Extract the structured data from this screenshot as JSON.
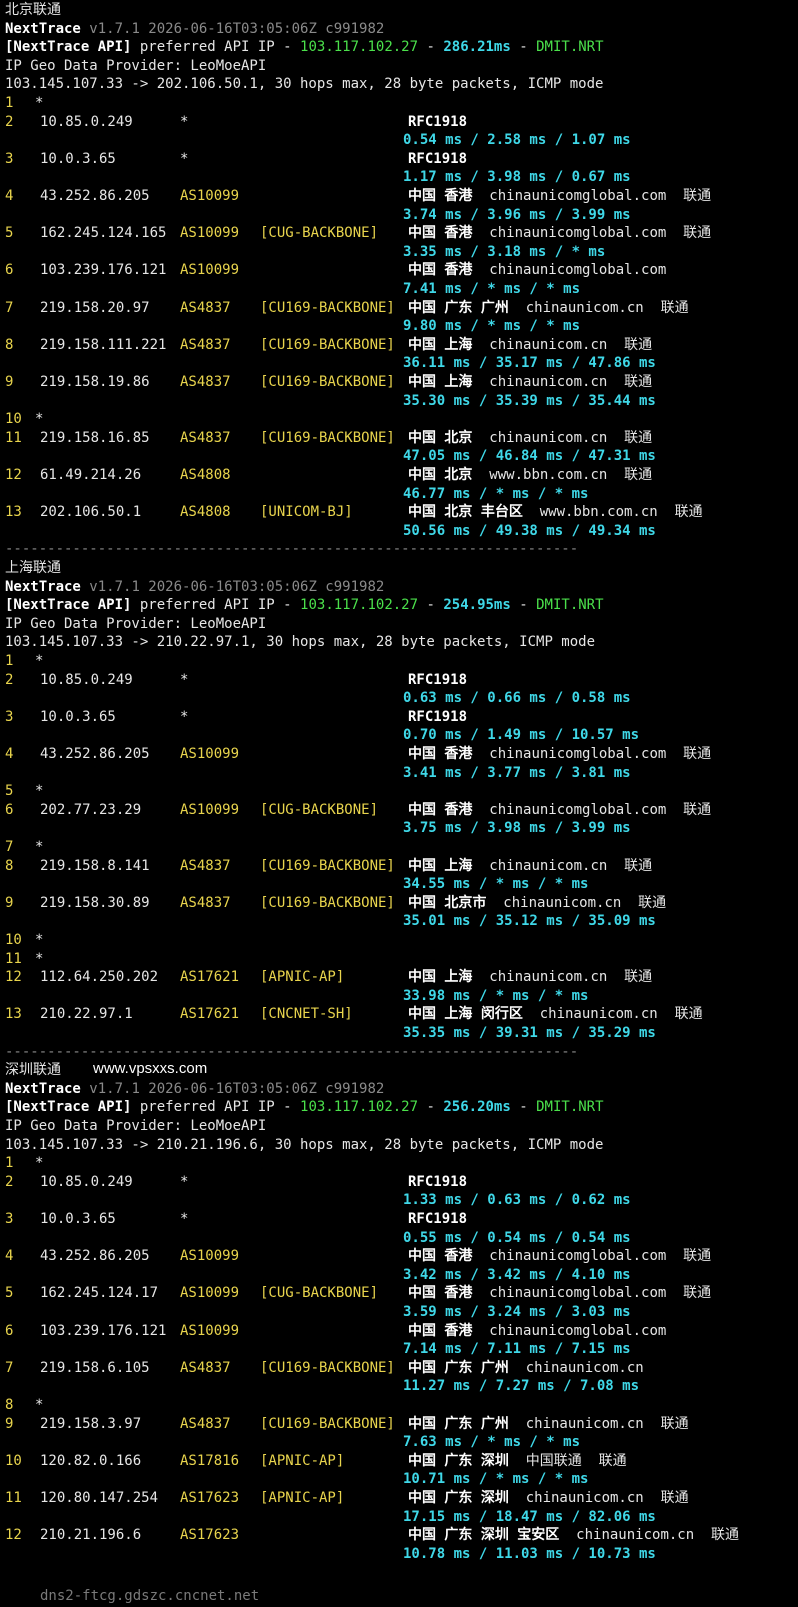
{
  "separator": "--------------------------------------------------------------------",
  "watermark": "www.vpsxxs.com",
  "overlay_hostname": "dns2-ftcg.gdszc.cncnet.net",
  "sections": [
    {
      "title": "北京联通",
      "nt_name": "NextTrace",
      "nt_version": "v1.7.1 2026-06-16T03:05:06Z c991982",
      "api_tag": "[NextTrace API]",
      "api_text": "preferred API IP -",
      "api_ip": "103.117.102.27",
      "api_dash1": "-",
      "api_latency": "286.21ms",
      "api_dash2": "-",
      "api_node": "DMIT.NRT",
      "provider": "IP Geo Data Provider: LeoMoeAPI",
      "route": "103.145.107.33 -> 202.106.50.1, 30 hops max, 28 byte packets, ICMP mode",
      "hops": [
        {
          "n": "1",
          "ip": "*",
          "asn": "",
          "tag": "",
          "geo": "",
          "rtt": ""
        },
        {
          "n": "2",
          "ip": "10.85.0.249",
          "asn": "*",
          "tag": "",
          "geo": "RFC1918",
          "rtt": "0.54 ms / 2.58 ms / 1.07 ms"
        },
        {
          "n": "3",
          "ip": "10.0.3.65",
          "asn": "*",
          "tag": "",
          "geo": "RFC1918",
          "rtt": "1.17 ms / 3.98 ms / 0.67 ms"
        },
        {
          "n": "4",
          "ip": "43.252.86.205",
          "asn": "AS10099",
          "tag": "",
          "geo": "中国 香港",
          "host": "chinaunicomglobal.com",
          "isp": "联通",
          "rtt": "3.74 ms / 3.96 ms / 3.99 ms"
        },
        {
          "n": "5",
          "ip": "162.245.124.165",
          "asn": "AS10099",
          "tag": "[CUG-BACKBONE]",
          "geo": "中国 香港",
          "host": "chinaunicomglobal.com",
          "isp": "联通",
          "rtt": "3.35 ms / 3.18 ms / * ms"
        },
        {
          "n": "6",
          "ip": "103.239.176.121",
          "asn": "AS10099",
          "tag": "",
          "geo": "中国 香港",
          "host": "chinaunicomglobal.com",
          "isp": "",
          "rtt": "7.41 ms / * ms / * ms"
        },
        {
          "n": "7",
          "ip": "219.158.20.97",
          "asn": "AS4837",
          "tag": "[CU169-BACKBONE]",
          "geo": "中国 广东 广州",
          "host": "chinaunicom.cn",
          "isp": "联通",
          "rtt": "9.80 ms / * ms / * ms"
        },
        {
          "n": "8",
          "ip": "219.158.111.221",
          "asn": "AS4837",
          "tag": "[CU169-BACKBONE]",
          "geo": "中国 上海",
          "host": "chinaunicom.cn",
          "isp": "联通",
          "rtt": "36.11 ms / 35.17 ms / 47.86 ms"
        },
        {
          "n": "9",
          "ip": "219.158.19.86",
          "asn": "AS4837",
          "tag": "[CU169-BACKBONE]",
          "geo": "中国 上海",
          "host": "chinaunicom.cn",
          "isp": "联通",
          "rtt": "35.30 ms / 35.39 ms / 35.44 ms"
        },
        {
          "n": "10",
          "ip": "*",
          "asn": "",
          "tag": "",
          "geo": "",
          "rtt": ""
        },
        {
          "n": "11",
          "ip": "219.158.16.85",
          "asn": "AS4837",
          "tag": "[CU169-BACKBONE]",
          "geo": "中国 北京",
          "host": "chinaunicom.cn",
          "isp": "联通",
          "rtt": "47.05 ms / 46.84 ms / 47.31 ms"
        },
        {
          "n": "12",
          "ip": "61.49.214.26",
          "asn": "AS4808",
          "tag": "",
          "geo": "中国 北京",
          "host": "www.bbn.com.cn",
          "isp": "联通",
          "rtt": "46.77 ms / * ms / * ms"
        },
        {
          "n": "13",
          "ip": "202.106.50.1",
          "asn": "AS4808",
          "tag": "[UNICOM-BJ]",
          "geo": "中国 北京 丰台区",
          "host": "www.bbn.com.cn",
          "isp": "联通",
          "rtt": "50.56 ms / 49.38 ms / 49.34 ms"
        }
      ]
    },
    {
      "title": "上海联通",
      "nt_name": "NextTrace",
      "nt_version": "v1.7.1 2026-06-16T03:05:06Z c991982",
      "api_tag": "[NextTrace API]",
      "api_text": "preferred API IP -",
      "api_ip": "103.117.102.27",
      "api_dash1": "-",
      "api_latency": "254.95ms",
      "api_dash2": "-",
      "api_node": "DMIT.NRT",
      "provider": "IP Geo Data Provider: LeoMoeAPI",
      "route": "103.145.107.33 -> 210.22.97.1, 30 hops max, 28 byte packets, ICMP mode",
      "hops": [
        {
          "n": "1",
          "ip": "*",
          "asn": "",
          "tag": "",
          "geo": "",
          "rtt": ""
        },
        {
          "n": "2",
          "ip": "10.85.0.249",
          "asn": "*",
          "tag": "",
          "geo": "RFC1918",
          "rtt": "0.63 ms / 0.66 ms / 0.58 ms"
        },
        {
          "n": "3",
          "ip": "10.0.3.65",
          "asn": "*",
          "tag": "",
          "geo": "RFC1918",
          "rtt": "0.70 ms / 1.49 ms / 10.57 ms"
        },
        {
          "n": "4",
          "ip": "43.252.86.205",
          "asn": "AS10099",
          "tag": "",
          "geo": "中国 香港",
          "host": "chinaunicomglobal.com",
          "isp": "联通",
          "rtt": "3.41 ms / 3.77 ms / 3.81 ms"
        },
        {
          "n": "5",
          "ip": "*",
          "asn": "",
          "tag": "",
          "geo": "",
          "rtt": ""
        },
        {
          "n": "6",
          "ip": "202.77.23.29",
          "asn": "AS10099",
          "tag": "[CUG-BACKBONE]",
          "geo": "中国 香港",
          "host": "chinaunicomglobal.com",
          "isp": "联通",
          "rtt": "3.75 ms / 3.98 ms / 3.99 ms"
        },
        {
          "n": "7",
          "ip": "*",
          "asn": "",
          "tag": "",
          "geo": "",
          "rtt": ""
        },
        {
          "n": "8",
          "ip": "219.158.8.141",
          "asn": "AS4837",
          "tag": "[CU169-BACKBONE]",
          "geo": "中国 上海",
          "host": "chinaunicom.cn",
          "isp": "联通",
          "rtt": "34.55 ms / * ms / * ms"
        },
        {
          "n": "9",
          "ip": "219.158.30.89",
          "asn": "AS4837",
          "tag": "[CU169-BACKBONE]",
          "geo": "中国 北京市",
          "host": "chinaunicom.cn",
          "isp": "联通",
          "rtt": "35.01 ms / 35.12 ms / 35.09 ms"
        },
        {
          "n": "10",
          "ip": "*",
          "asn": "",
          "tag": "",
          "geo": "",
          "rtt": ""
        },
        {
          "n": "11",
          "ip": "*",
          "asn": "",
          "tag": "",
          "geo": "",
          "rtt": ""
        },
        {
          "n": "12",
          "ip": "112.64.250.202",
          "asn": "AS17621",
          "tag": "[APNIC-AP]",
          "geo": "中国 上海",
          "host": "chinaunicom.cn",
          "isp": "联通",
          "rtt": "33.98 ms / * ms / * ms"
        },
        {
          "n": "13",
          "ip": "210.22.97.1",
          "asn": "AS17621",
          "tag": "[CNCNET-SH]",
          "geo": "中国 上海 闵行区",
          "host": "chinaunicom.cn",
          "isp": "联通",
          "rtt": "35.35 ms / 39.31 ms / 35.29 ms"
        }
      ]
    },
    {
      "title": "深圳联通",
      "nt_name": "NextTrace",
      "nt_version": "v1.7.1 2026-06-16T03:05:06Z c991982",
      "api_tag": "[NextTrace API]",
      "api_text": "preferred API IP -",
      "api_ip": "103.117.102.27",
      "api_dash1": "-",
      "api_latency": "256.20ms",
      "api_dash2": "-",
      "api_node": "DMIT.NRT",
      "provider": "IP Geo Data Provider: LeoMoeAPI",
      "route": "103.145.107.33 -> 210.21.196.6, 30 hops max, 28 byte packets, ICMP mode",
      "hops": [
        {
          "n": "1",
          "ip": "*",
          "asn": "",
          "tag": "",
          "geo": "",
          "rtt": ""
        },
        {
          "n": "2",
          "ip": "10.85.0.249",
          "asn": "*",
          "tag": "",
          "geo": "RFC1918",
          "rtt": "1.33 ms / 0.63 ms / 0.62 ms"
        },
        {
          "n": "3",
          "ip": "10.0.3.65",
          "asn": "*",
          "tag": "",
          "geo": "RFC1918",
          "rtt": "0.55 ms / 0.54 ms / 0.54 ms"
        },
        {
          "n": "4",
          "ip": "43.252.86.205",
          "asn": "AS10099",
          "tag": "",
          "geo": "中国 香港",
          "host": "chinaunicomglobal.com",
          "isp": "联通",
          "rtt": "3.42 ms / 3.42 ms / 4.10 ms"
        },
        {
          "n": "5",
          "ip": "162.245.124.17",
          "asn": "AS10099",
          "tag": "[CUG-BACKBONE]",
          "geo": "中国 香港",
          "host": "chinaunicomglobal.com",
          "isp": "联通",
          "rtt": "3.59 ms / 3.24 ms / 3.03 ms"
        },
        {
          "n": "6",
          "ip": "103.239.176.121",
          "asn": "AS10099",
          "tag": "",
          "geo": "中国 香港",
          "host": "chinaunicomglobal.com",
          "isp": "",
          "rtt": "7.14 ms / 7.11 ms / 7.15 ms"
        },
        {
          "n": "7",
          "ip": "219.158.6.105",
          "asn": "AS4837",
          "tag": "[CU169-BACKBONE]",
          "geo": "中国 广东 广州",
          "host": "chinaunicom.cn",
          "isp": "",
          "rtt": "11.27 ms / 7.27 ms / 7.08 ms"
        },
        {
          "n": "8",
          "ip": "*",
          "asn": "",
          "tag": "",
          "geo": "",
          "rtt": ""
        },
        {
          "n": "9",
          "ip": "219.158.3.97",
          "asn": "AS4837",
          "tag": "[CU169-BACKBONE]",
          "geo": "中国 广东 广州",
          "host": "chinaunicom.cn",
          "isp": "联通",
          "rtt": "7.63 ms / * ms / * ms"
        },
        {
          "n": "10",
          "ip": "120.82.0.166",
          "asn": "AS17816",
          "tag": "[APNIC-AP]",
          "geo": "中国 广东 深圳",
          "host": "中国联通",
          "isp": "联通",
          "rtt": "10.71 ms / * ms / * ms"
        },
        {
          "n": "11",
          "ip": "120.80.147.254",
          "asn": "AS17623",
          "tag": "[APNIC-AP]",
          "geo": "中国 广东 深圳",
          "host": "chinaunicom.cn",
          "isp": "联通",
          "rtt": "17.15 ms / 18.47 ms / 82.06 ms"
        },
        {
          "n": "12",
          "ip": "210.21.196.6",
          "asn": "AS17623",
          "tag": "",
          "geo": "中国 广东 深圳 宝安区",
          "host": "chinaunicom.cn",
          "isp": "联通",
          "rtt": "10.78 ms / 11.03 ms / 10.73 ms"
        }
      ]
    }
  ]
}
